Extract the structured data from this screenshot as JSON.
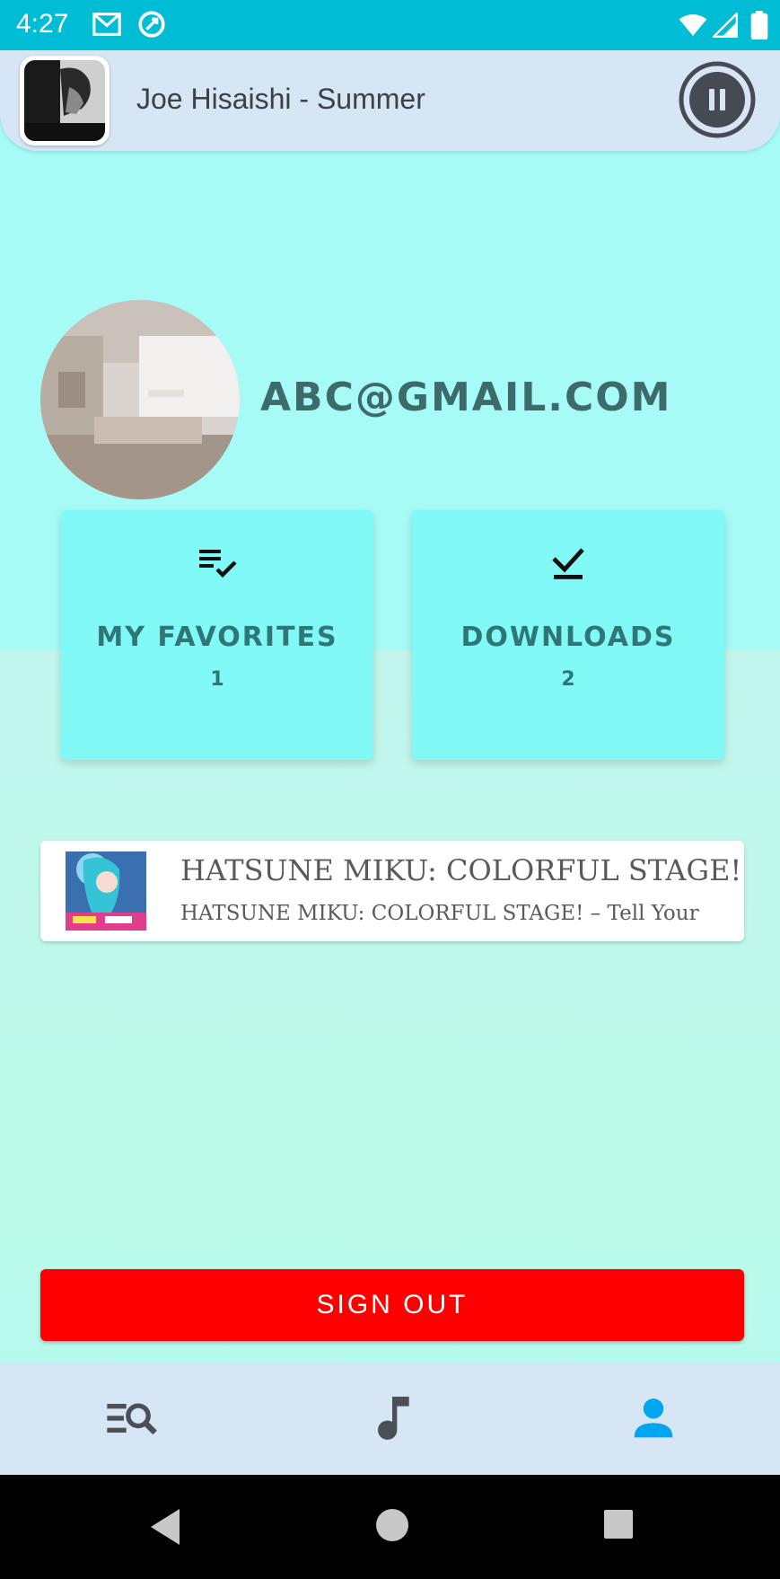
{
  "status_bar": {
    "time": "4:27"
  },
  "now_playing": {
    "title": "Joe Hisaishi - Summer"
  },
  "profile": {
    "email": "ABC@GMAIL.COM"
  },
  "stats": [
    {
      "label": "MY FAVORITES",
      "count": "1"
    },
    {
      "label": "DOWNLOADS",
      "count": "2"
    }
  ],
  "songs": [
    {
      "title": "HATSUNE MIKU: COLORFUL STAGE!",
      "subtitle": "HATSUNE MIKU: COLORFUL STAGE!   –   Tell Your"
    }
  ],
  "sign_out_label": "SIGN OUT",
  "colors": {
    "status_bar": "#00bcd4",
    "accent": "#00a6f0",
    "sign_out": "#ff0000",
    "card": "#80f9f7",
    "text_teal": "#3d6b6b"
  },
  "icons": {
    "status": [
      "gmail-icon",
      "sync-icon",
      "wifi-icon",
      "signal-icon",
      "battery-icon"
    ],
    "nav": [
      "search-list-icon",
      "music-note-icon",
      "person-icon"
    ],
    "system": [
      "back-icon",
      "home-icon",
      "recents-icon"
    ]
  }
}
